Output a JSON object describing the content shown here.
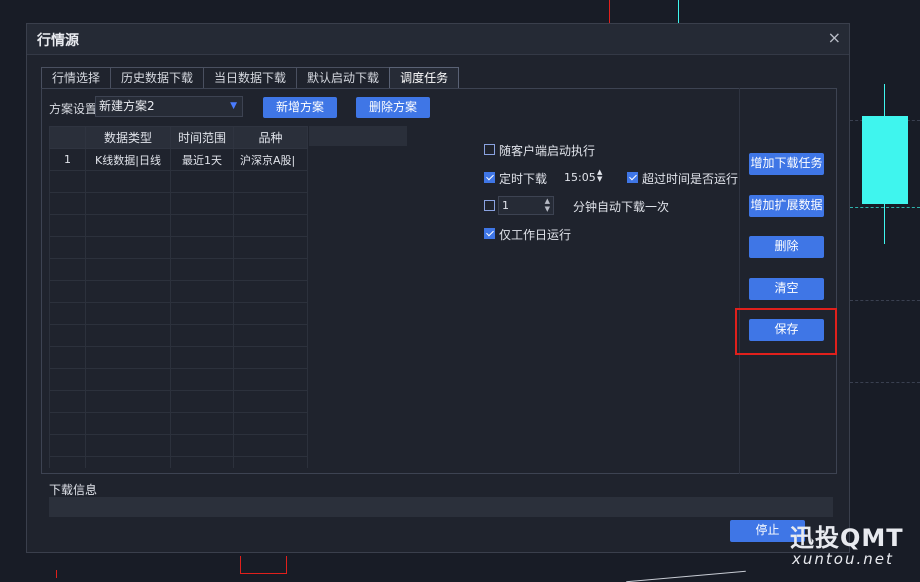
{
  "window": {
    "title": "行情源",
    "close_glyph": "×"
  },
  "tabs": [
    {
      "label": "行情选择"
    },
    {
      "label": "历史数据下载"
    },
    {
      "label": "当日数据下载"
    },
    {
      "label": "默认启动下载"
    },
    {
      "label": "调度任务"
    }
  ],
  "active_tab": "调度任务",
  "plan": {
    "label": "方案设置",
    "selected": "新建方案2",
    "add_button": "新增方案",
    "delete_button": "删除方案"
  },
  "table": {
    "headers": [
      "",
      "数据类型",
      "时间范围",
      "品种"
    ],
    "rows": [
      [
        "1",
        "K线数据|日线",
        "最近1天",
        "沪深京A股|"
      ]
    ]
  },
  "options": {
    "autostart": {
      "label": "随客户端启动执行",
      "checked": false
    },
    "scheduled": {
      "label": "定时下载",
      "checked": true,
      "time": "15:05"
    },
    "overtime": {
      "label": "超过时间是否运行",
      "checked": true
    },
    "interval": {
      "checked": false,
      "value": "1",
      "suffix": "分钟自动下载一次"
    },
    "workday": {
      "label": "仅工作日运行",
      "checked": true
    }
  },
  "side_buttons": {
    "add_task": "增加下载任务",
    "add_ext": "增加扩展数据",
    "delete": "删除",
    "clear": "清空",
    "save": "保存"
  },
  "download_info": {
    "label": "下载信息"
  },
  "stop_button": "停止",
  "watermark": {
    "brand": "迅投QMT",
    "url": "xuntou.net"
  },
  "colors": {
    "accent": "#3f76e6",
    "highlight": "#e0201c",
    "candle": "#3ff5ee"
  }
}
